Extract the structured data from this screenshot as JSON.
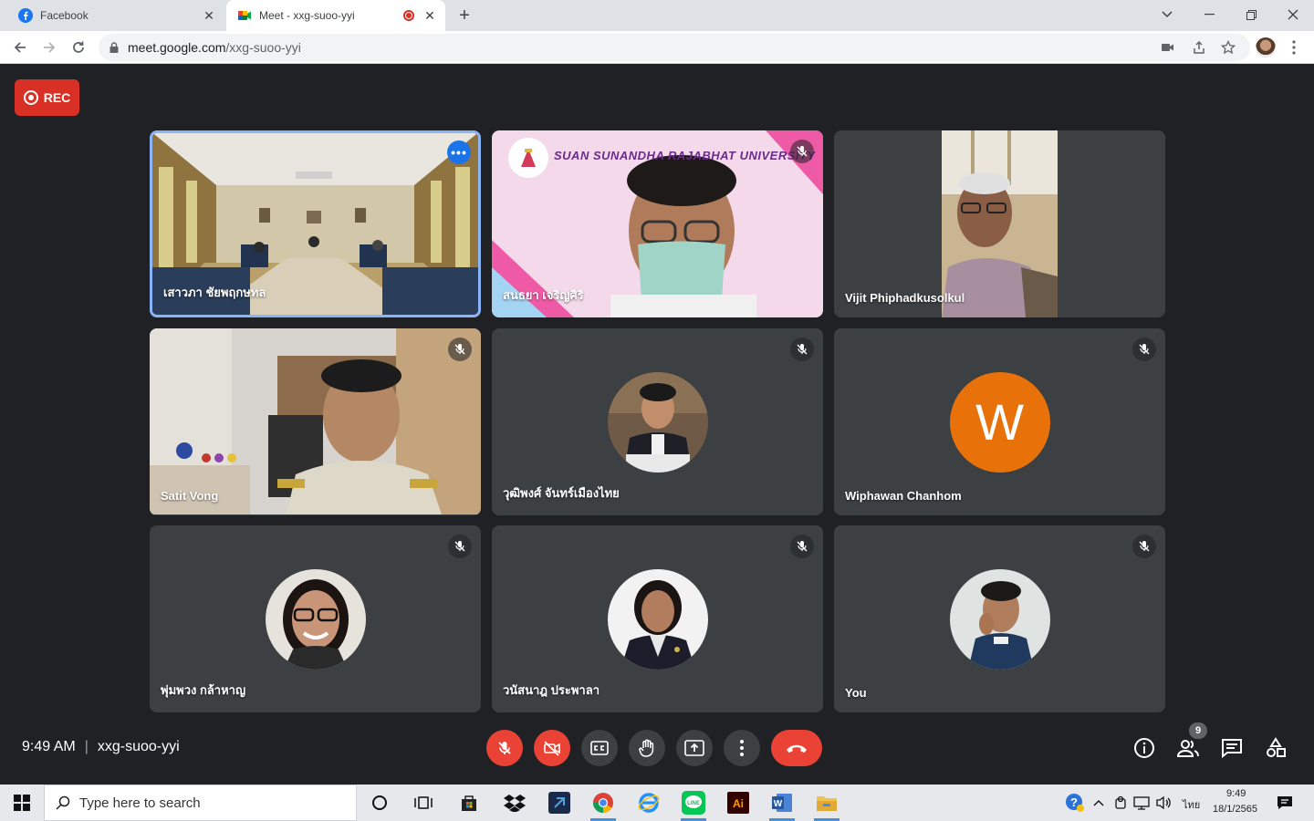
{
  "browser": {
    "tabs": [
      {
        "title": "Facebook",
        "active": false
      },
      {
        "title": "Meet - xxg-suoo-yyi",
        "active": true
      }
    ],
    "url_host": "meet.google.com",
    "url_path": "/xxg-suoo-yyi"
  },
  "meet": {
    "rec_label": "REC",
    "time": "9:49 AM",
    "separator": "|",
    "meeting_code": "xxg-suoo-yyi",
    "participant_count": "9",
    "tiles": [
      {
        "name": "เสาวภา ชัยพฤกษทล",
        "kind": "video-room",
        "muted": false,
        "pinned": true
      },
      {
        "name": "สนธยา เจริญศิริ",
        "kind": "video-mask",
        "muted": true,
        "banner": "SUAN SUNANDHA RAJABHAT UNIVERSITY"
      },
      {
        "name": "Vijit Phiphadkusolkul",
        "kind": "video-elder",
        "muted": false
      },
      {
        "name": "Satit Vong",
        "kind": "video-uniform",
        "muted": true
      },
      {
        "name": "วุฒิพงศ์ จันทร์เมืองไทย",
        "kind": "avatar-photo",
        "muted": true
      },
      {
        "name": "Wiphawan Chanhom",
        "kind": "avatar-letter",
        "letter": "W",
        "avatar_color": "#e8710a",
        "muted": true
      },
      {
        "name": "พุ่มพวง กล้าหาญ",
        "kind": "avatar-photo",
        "muted": true
      },
      {
        "name": "วนัสนาฎ ประพาลา",
        "kind": "avatar-photo",
        "muted": true
      },
      {
        "name": "You",
        "kind": "avatar-photo",
        "muted": true
      }
    ]
  },
  "taskbar": {
    "search_placeholder": "Type here to search",
    "tray_lang": "ไทย",
    "tray_time": "9:49",
    "tray_date": "18/1/2565"
  },
  "colors": {
    "meet_bg": "#202124",
    "tile_bg": "#3c4043",
    "red": "#ea4335",
    "rec_red": "#d93025",
    "pin_blue": "#8ab4f8"
  }
}
